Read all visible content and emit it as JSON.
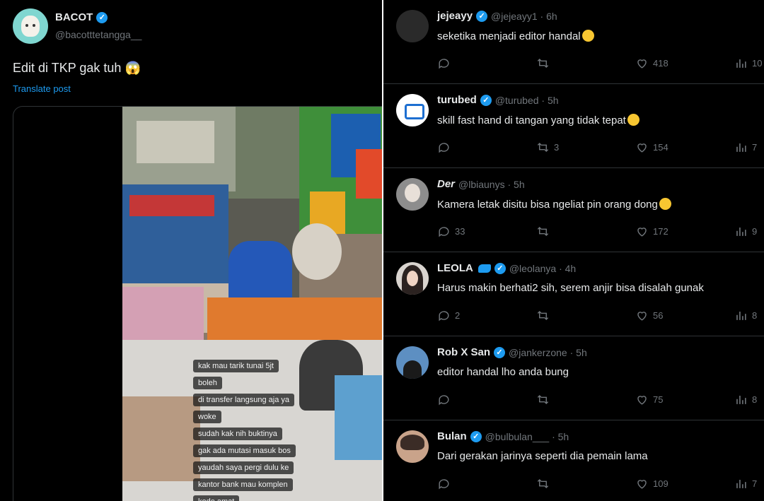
{
  "post": {
    "name": "BACOT",
    "handle": "@bacotttetangga__",
    "text": "Edit di TKP gak tuh",
    "translate": "Translate post",
    "overlay_chat": [
      "kak mau tarik tunai 5jt",
      "boleh",
      "di transfer langsung aja ya",
      "woke",
      "sudah kak nih buktinya",
      "gak ada mutasi masuk bos",
      "yaudah saya pergi dulu ke",
      "kantor bank mau komplen",
      "kode amat"
    ]
  },
  "replies": [
    {
      "name": "jejeayy",
      "handle": "@jejeayy1 · 6h",
      "text": "seketika menjadi editor handal",
      "emoji": true,
      "replies": "",
      "retweets": "",
      "likes": "418",
      "views": "10"
    },
    {
      "name": "turubed",
      "handle": "@turubed · 5h",
      "text": "skill fast hand di tangan yang tidak tepat",
      "emoji": true,
      "replies": "",
      "retweets": "3",
      "likes": "154",
      "views": "7"
    },
    {
      "name": "Der",
      "handle": "@lbiaunys · 5h",
      "text": "Kamera letak disitu bisa ngeliat pin orang dong",
      "emoji": true,
      "replies": "33",
      "retweets": "",
      "likes": "172",
      "views": "9"
    },
    {
      "name": "LEOLA",
      "handle": "@leolanya · 4h",
      "text": "Harus makin berhati2 sih, serem anjir bisa disalah gunak",
      "emoji": false,
      "replies": "2",
      "retweets": "",
      "likes": "56",
      "views": "8"
    },
    {
      "name": "Rob X San",
      "handle": "@jankerzone · 5h",
      "text": "editor handal lho anda bung",
      "emoji": false,
      "replies": "",
      "retweets": "",
      "likes": "75",
      "views": "8"
    },
    {
      "name": "Bulan",
      "handle": "@bulbulan___ · 5h",
      "text": "Dari gerakan jarinya seperti dia pemain lama",
      "emoji": false,
      "replies": "",
      "retweets": "",
      "likes": "109",
      "views": "7"
    }
  ],
  "colors": {
    "background": "#000000",
    "text": "#e7e9ea",
    "secondary": "#71767b",
    "accent": "#1d9bf0",
    "divider": "#2f3336"
  }
}
